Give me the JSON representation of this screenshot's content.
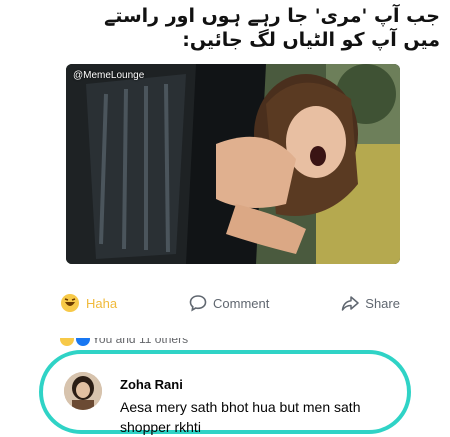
{
  "caption": {
    "line1": "جب آپ 'مری' جا رہے ہوں اور راستے",
    "line2": "میں آپ کو الٹیاں لگ جائیں:"
  },
  "photo": {
    "watermark": "@MemeLounge"
  },
  "actions": {
    "haha_label": "Haha",
    "comment_label": "Comment",
    "share_label": "Share"
  },
  "reactions": {
    "text": "You and 11 others"
  },
  "comment": {
    "author": "Zoha Rani",
    "text": "Aesa mery sath bhot hua but men sath shopper rkhti"
  },
  "colors": {
    "highlight": "#2fd3c6",
    "haha": "#f0ba3b",
    "action_text": "#606770"
  }
}
